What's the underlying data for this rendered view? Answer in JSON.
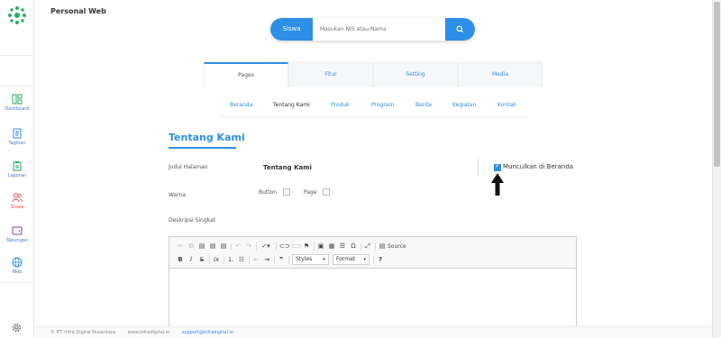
{
  "app": {
    "title": "Personal Web",
    "accent": "#2e8fe6"
  },
  "sidebar": {
    "items": [
      {
        "label": "Dashboard",
        "icon": "dashboard-icon"
      },
      {
        "label": "Tagihan",
        "icon": "invoice-icon"
      },
      {
        "label": "Laporan",
        "icon": "report-icon"
      },
      {
        "label": "Siswa",
        "icon": "users-icon",
        "active": true
      },
      {
        "label": "Tabungan",
        "icon": "wallet-icon"
      },
      {
        "label": "Web",
        "icon": "globe-icon"
      }
    ],
    "settings_icon": "gear-icon"
  },
  "search": {
    "mode_label": "Siswa",
    "placeholder": "Masukan NIS atau Nama",
    "value": ""
  },
  "tabs": [
    {
      "label": "Pages",
      "active": true
    },
    {
      "label": "Fitur"
    },
    {
      "label": "Setting"
    },
    {
      "label": "Media"
    }
  ],
  "subnav": [
    {
      "label": "Beranda"
    },
    {
      "label": "Tentang Kami",
      "active": true
    },
    {
      "label": "Produk"
    },
    {
      "label": "Program"
    },
    {
      "label": "Berita"
    },
    {
      "label": "Kegiatan"
    },
    {
      "label": "Kontak"
    }
  ],
  "form": {
    "section_title": "Tentang Kami",
    "judul_label": "Judul Halaman",
    "judul_value": "Tentang Kami",
    "tampil_label": "Munculkan di Beranda",
    "tampil_checked": true,
    "warna_label": "Warna",
    "button_label": "Button",
    "button_checked": false,
    "page_label": "Page",
    "page_checked": false,
    "deskripsi_label": "Deskripsi Singkat"
  },
  "editor": {
    "source_label": "Source",
    "styles_label": "Styles",
    "format_label": "Format"
  },
  "footer": {
    "company": "© PT. Infra Digital Nusantara",
    "website": "www.infradigital.io",
    "email": "support@infradigital.io"
  }
}
